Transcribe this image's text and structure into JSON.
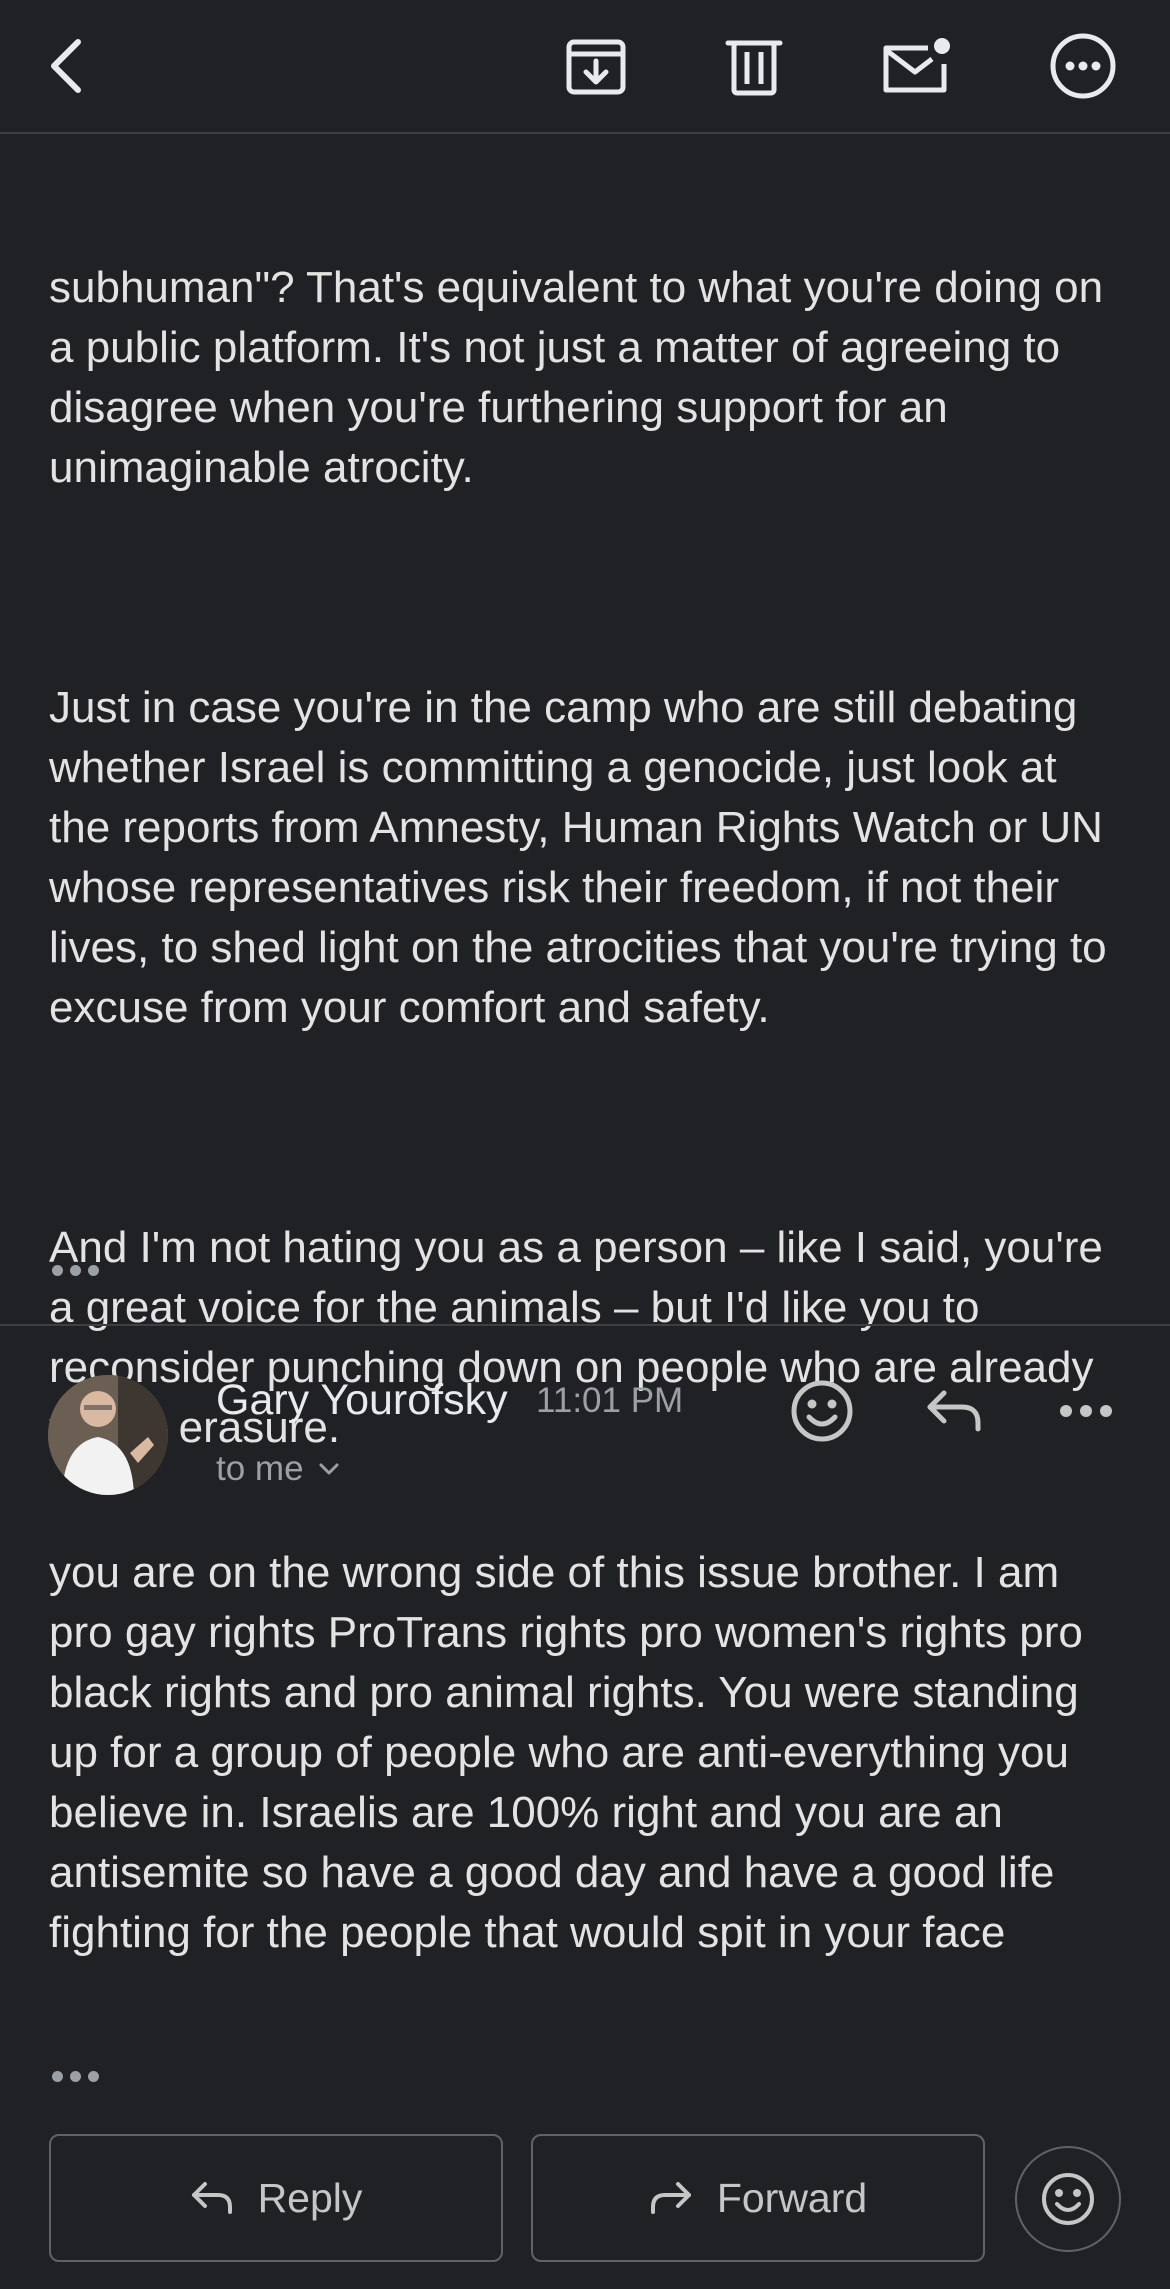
{
  "toolbar": {
    "back_icon": "chevron-left-icon",
    "archive_icon": "archive-icon",
    "delete_icon": "trash-icon",
    "mark_unread_icon": "mail-unread-icon",
    "more_icon": "more-horizontal-icon"
  },
  "previous_message": {
    "paragraphs": [
      "subhuman\"? That's equivalent to what you're doing on a public platform. It's not just a matter of agreeing to disagree when you're furthering support for an unimaginable atrocity.",
      "Just in case you're in the camp who are still debating whether Israel is committing a genocide, just look at the reports from Amnesty, Human Rights Watch or UN whose representatives risk their freedom, if not their lives, to shed light on the atrocities that you're trying to excuse from your comfort and safety.",
      "And I'm not hating you as a person – like I said, you're a great voice for the animals – but I'd like you to reconsider punching down on people who are already facing erasure."
    ],
    "trimmed_icon": "ellipsis-icon"
  },
  "message": {
    "sender": "Gary Yourofsky",
    "time": "11:01 PM",
    "recipient": "to me",
    "body": "you are on the wrong side of this issue brother. I am pro gay rights ProTrans rights pro women's rights pro black rights and pro animal rights. You were standing up for a group of people who are anti-everything you believe in. Israelis are 100% right and you are an antisemite so have a good day and have a good life fighting for the people that would spit in your face",
    "trimmed_icon": "ellipsis-icon"
  },
  "actions": {
    "reply_label": "Reply",
    "forward_label": "Forward"
  },
  "colors": {
    "background": "#202124",
    "text": "#e3e3e3",
    "secondary_text": "#9aa0a6",
    "border": "#5f6368"
  }
}
